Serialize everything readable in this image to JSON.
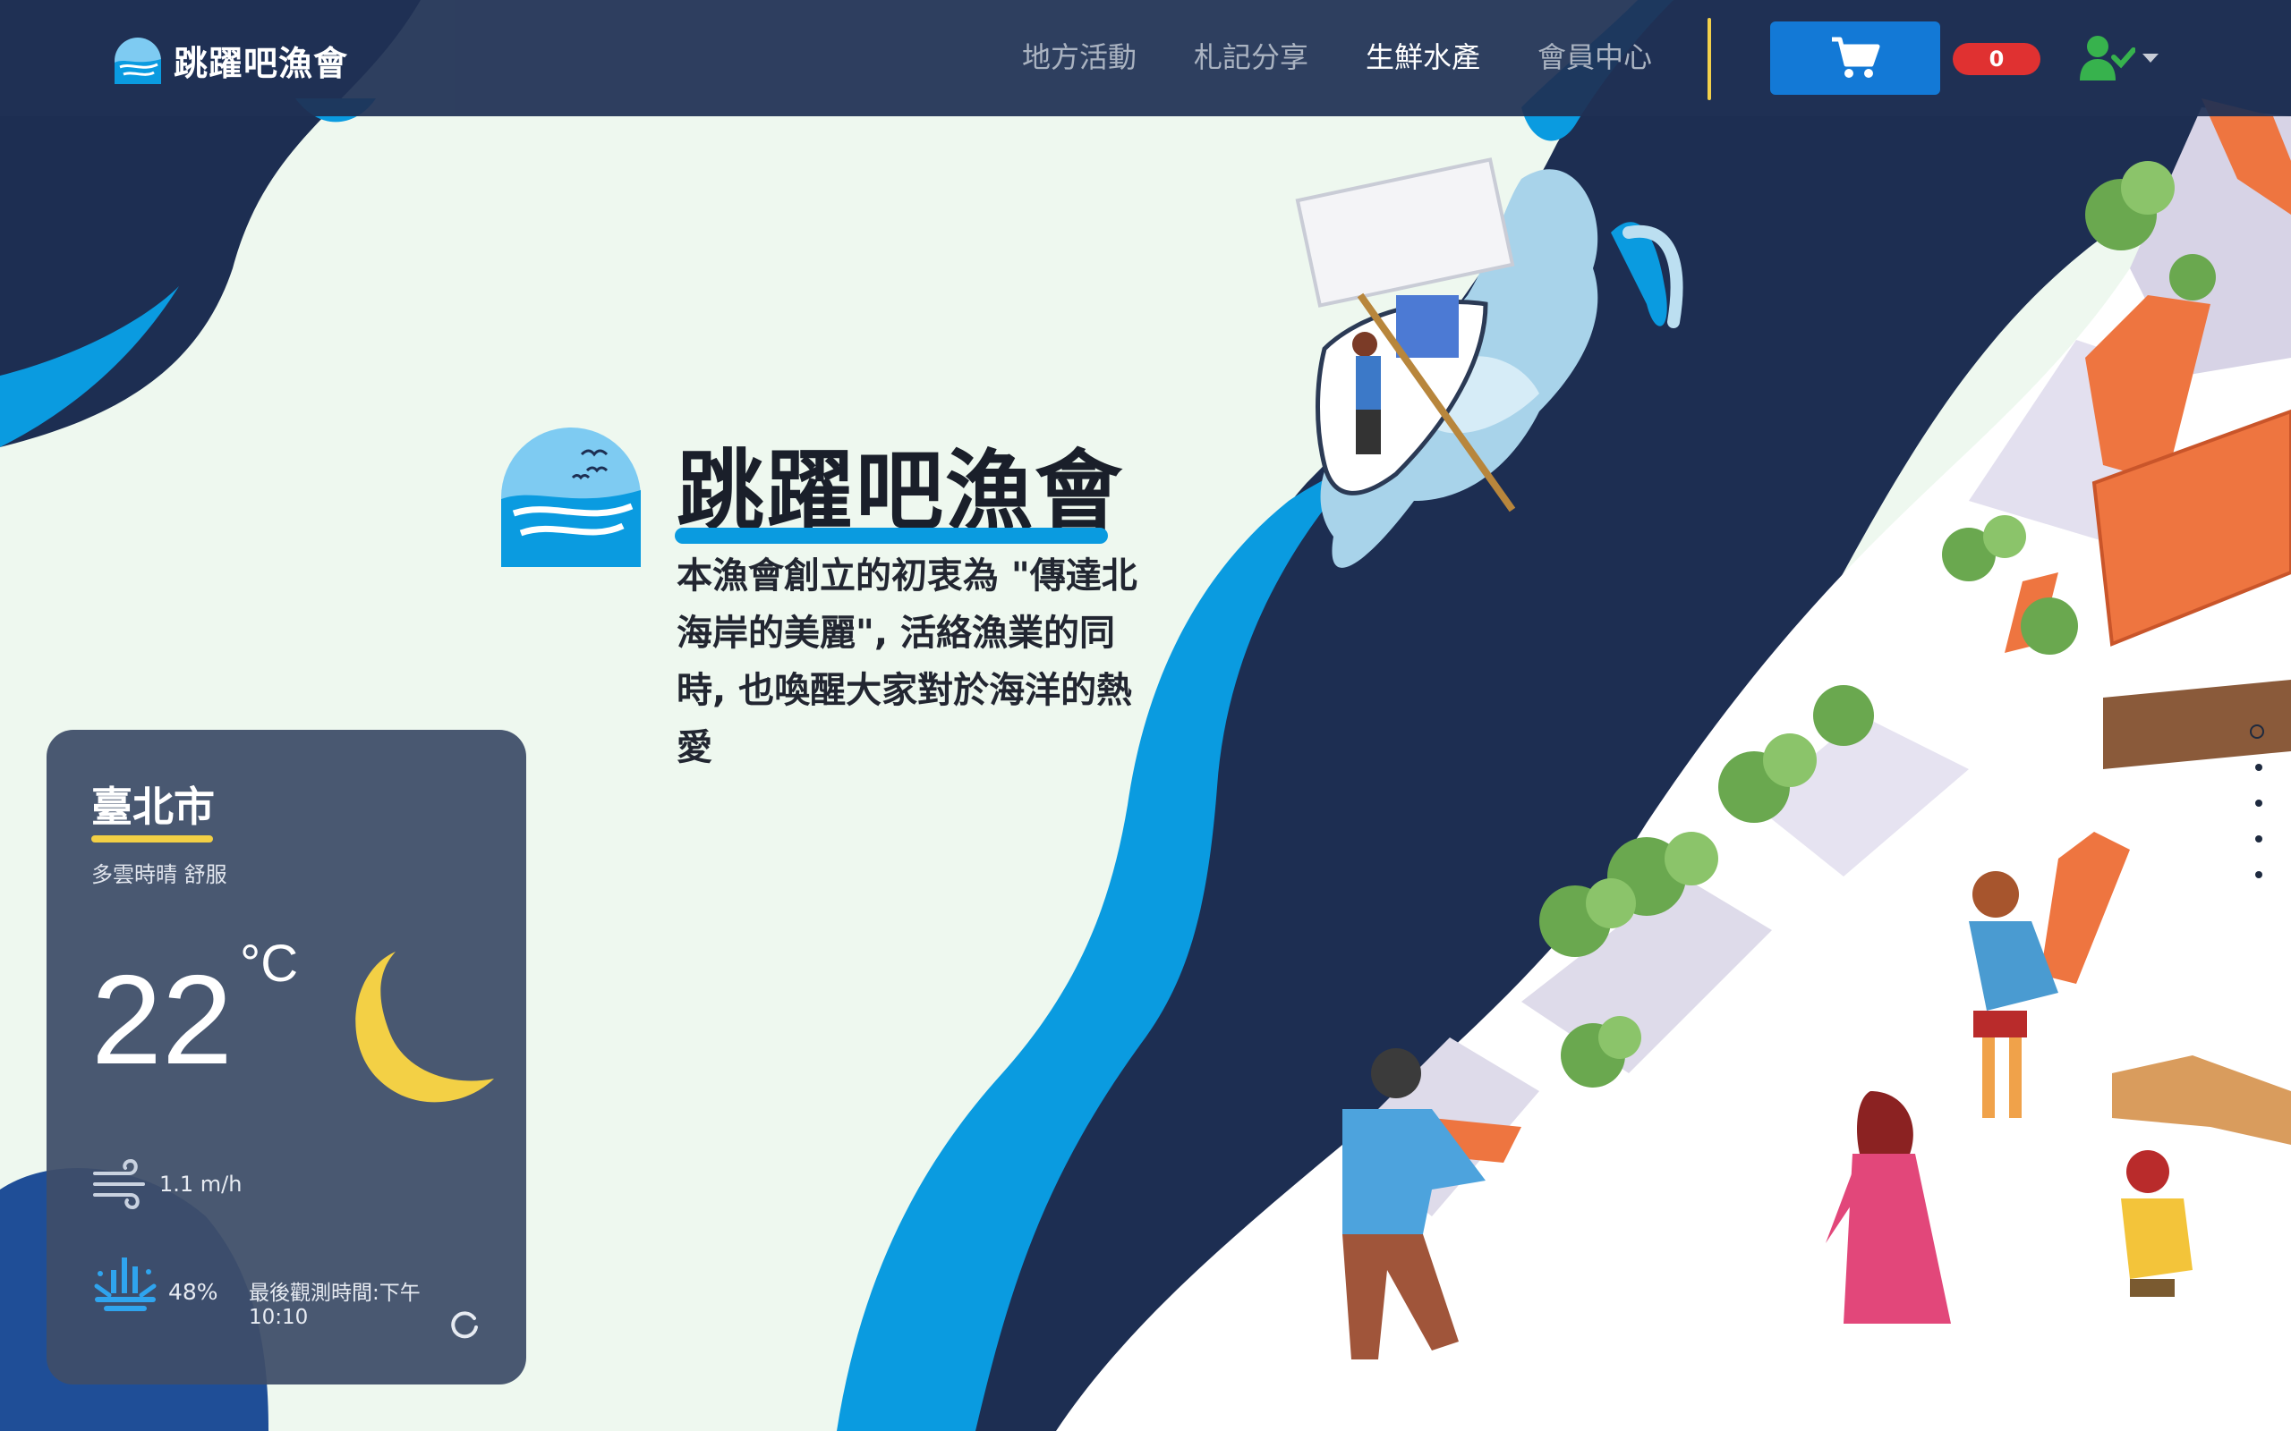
{
  "brand": {
    "name": "跳躍吧漁會",
    "logo_icon": "sea-sunrise-logo-icon"
  },
  "nav": {
    "items": [
      {
        "label": "地方活動",
        "active": false
      },
      {
        "label": "札記分享",
        "active": false
      },
      {
        "label": "生鮮水產",
        "active": true
      },
      {
        "label": "會員中心",
        "active": false
      }
    ],
    "divider_color": "#f2d04b"
  },
  "cart": {
    "icon": "shopping-cart-icon",
    "count": "0",
    "button_color": "#1379d6",
    "badge_color": "#e03131"
  },
  "user_menu": {
    "icon": "user-check-icon",
    "caret_icon": "caret-down-icon",
    "accent": "#37b24d"
  },
  "hero": {
    "title": "跳躍吧漁會",
    "description": "本漁會創立的初衷為 \"傳達北海岸的美麗\", 活絡漁業的同時, 也喚醒大家對於海洋的熱愛",
    "underline_color": "#0a9be0"
  },
  "weather": {
    "city": "臺北市",
    "description": "多雲時晴 舒服",
    "temperature": "22",
    "unit": "°C",
    "condition_icon": "crescent-moon-icon",
    "wind": "1.1 m/h",
    "wind_icon": "wind-icon",
    "humidity": "48%",
    "humidity_icon": "humidity-icon",
    "observation_label": "最後觀測時間:下午",
    "observation_time": "10:10",
    "refresh_icon": "refresh-icon",
    "accent": "#f3d045"
  },
  "scroll_nav": {
    "count": 5,
    "active_index": 0
  },
  "colors": {
    "navy": "#1d2e52",
    "sea_blue": "#0a9be0",
    "background": "#eef8ef",
    "roof_orange": "#ee7540"
  }
}
